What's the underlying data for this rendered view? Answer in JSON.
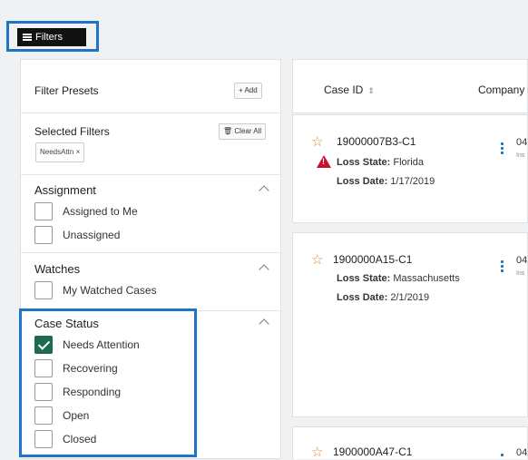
{
  "toolbar": {
    "filters_label": "Filters"
  },
  "presets": {
    "title": "Filter Presets",
    "add_label": "+ Add"
  },
  "selected": {
    "title": "Selected Filters",
    "clear_label": "Clear All",
    "tag": "NeedsAttn ×"
  },
  "assignment": {
    "title": "Assignment",
    "items": [
      "Assigned to Me",
      "Unassigned"
    ]
  },
  "watches": {
    "title": "Watches",
    "items": [
      "My Watched Cases"
    ]
  },
  "case_status": {
    "title": "Case Status",
    "items": [
      "Needs Attention",
      "Recovering",
      "Responding",
      "Open",
      "Closed"
    ]
  },
  "table": {
    "col_case_id": "Case ID",
    "col_company": "Company"
  },
  "cards": [
    {
      "id": "19000007B3-C1",
      "loss_state_label": "Loss State:",
      "loss_state": "Florida",
      "loss_date_label": "Loss Date:",
      "loss_date": "1/17/2019",
      "date_num": "04",
      "sub": "Ins"
    },
    {
      "id": "1900000A15-C1",
      "loss_state_label": "Loss State:",
      "loss_state": "Massachusetts",
      "loss_date_label": "Loss Date:",
      "loss_date": "2/1/2019",
      "date_num": "04",
      "sub": "Ins"
    },
    {
      "id": "1900000A47-C1",
      "date_num": "04"
    }
  ],
  "colors": {
    "accent_blue": "#1d74c9",
    "checkbox_green": "#1e6b4f",
    "warning_red": "#c8102e",
    "star_orange": "#e08a1e"
  }
}
